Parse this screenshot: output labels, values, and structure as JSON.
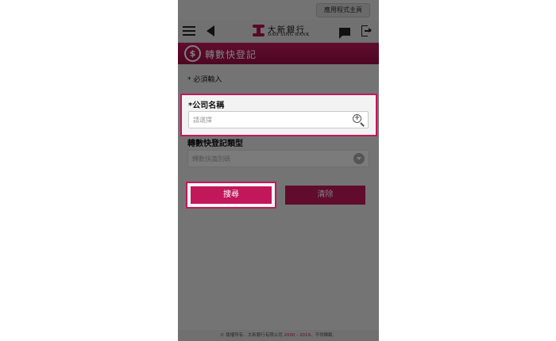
{
  "top": {
    "home_link": "應用程式主頁"
  },
  "bank": {
    "name_cn": "大新銀行",
    "name_en": "DAH SING BANK"
  },
  "page": {
    "title": "轉數快登記"
  },
  "form": {
    "required_note": "* 必須輸入",
    "company_label": "*公司名稱",
    "company_placeholder": "請選擇",
    "type_label": "轉數快登記類型",
    "type_value": "轉數快識別碼"
  },
  "buttons": {
    "search": "搜尋",
    "clear": "清除"
  },
  "footer": {
    "text_before": "© 版權所有．大新銀行有限公司 ",
    "years": "2000 - 2019",
    "text_after": "．不得轉載．"
  },
  "colors": {
    "brand": "#c2185b",
    "overlay": "rgba(0,0,0,0.5)"
  },
  "icons": [
    "menu-icon",
    "back-icon",
    "mail-icon",
    "logout-icon",
    "dollar-icon",
    "magnify-icon",
    "chevron-down-icon"
  ]
}
